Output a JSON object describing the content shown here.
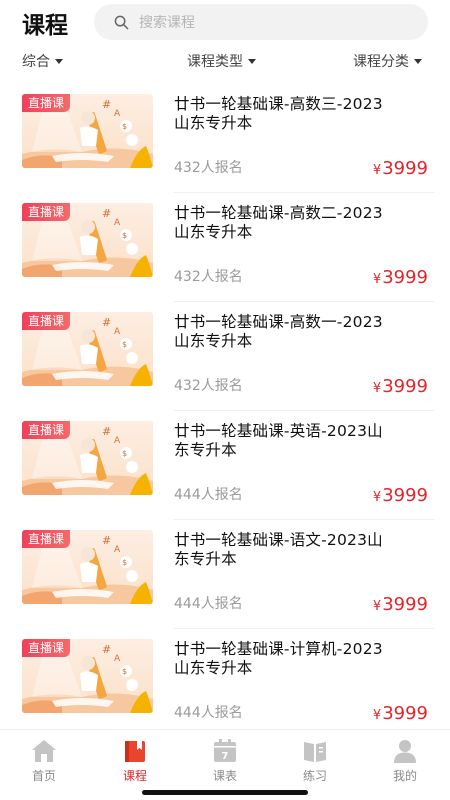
{
  "header": {
    "title": "课程"
  },
  "search": {
    "placeholder": "搜索课程"
  },
  "filters": [
    {
      "label": "综合"
    },
    {
      "label": "课程类型"
    },
    {
      "label": "课程分类"
    }
  ],
  "courses": [
    {
      "badge": "直播课",
      "title_line1": "廿书一轮基础课-高数三-2023",
      "title_line2": "山东专升本",
      "enroll": "432人报名",
      "currency": "¥",
      "price": "3999"
    },
    {
      "badge": "直播课",
      "title_line1": "廿书一轮基础课-高数二-2023",
      "title_line2": "山东专升本",
      "enroll": "432人报名",
      "currency": "¥",
      "price": "3999"
    },
    {
      "badge": "直播课",
      "title_line1": "廿书一轮基础课-高数一-2023",
      "title_line2": "山东专升本",
      "enroll": "432人报名",
      "currency": "¥",
      "price": "3999"
    },
    {
      "badge": "直播课",
      "title_line1": "廿书一轮基础课-英语-2023山",
      "title_line2": "东专升本",
      "enroll": "444人报名",
      "currency": "¥",
      "price": "3999"
    },
    {
      "badge": "直播课",
      "title_line1": "廿书一轮基础课-语文-2023山",
      "title_line2": "东专升本",
      "enroll": "444人报名",
      "currency": "¥",
      "price": "3999"
    },
    {
      "badge": "直播课",
      "title_line1": "廿书一轮基础课-计算机-2023",
      "title_line2": "山东专升本",
      "enroll": "444人报名",
      "currency": "¥",
      "price": "3999"
    }
  ],
  "tabs": [
    {
      "label": "首页",
      "icon": "home-icon",
      "active": false
    },
    {
      "label": "课程",
      "icon": "course-book-icon",
      "active": true
    },
    {
      "label": "课表",
      "icon": "calendar-icon",
      "calendar_day": "7",
      "active": false
    },
    {
      "label": "练习",
      "icon": "open-book-icon",
      "active": false
    },
    {
      "label": "我的",
      "icon": "user-icon",
      "active": false
    }
  ],
  "colors": {
    "accent": "#e5242a",
    "badge": "#f0405a",
    "tab_inactive": "#8a8a8a",
    "tab_icon_inactive": "#c4c4c4"
  }
}
